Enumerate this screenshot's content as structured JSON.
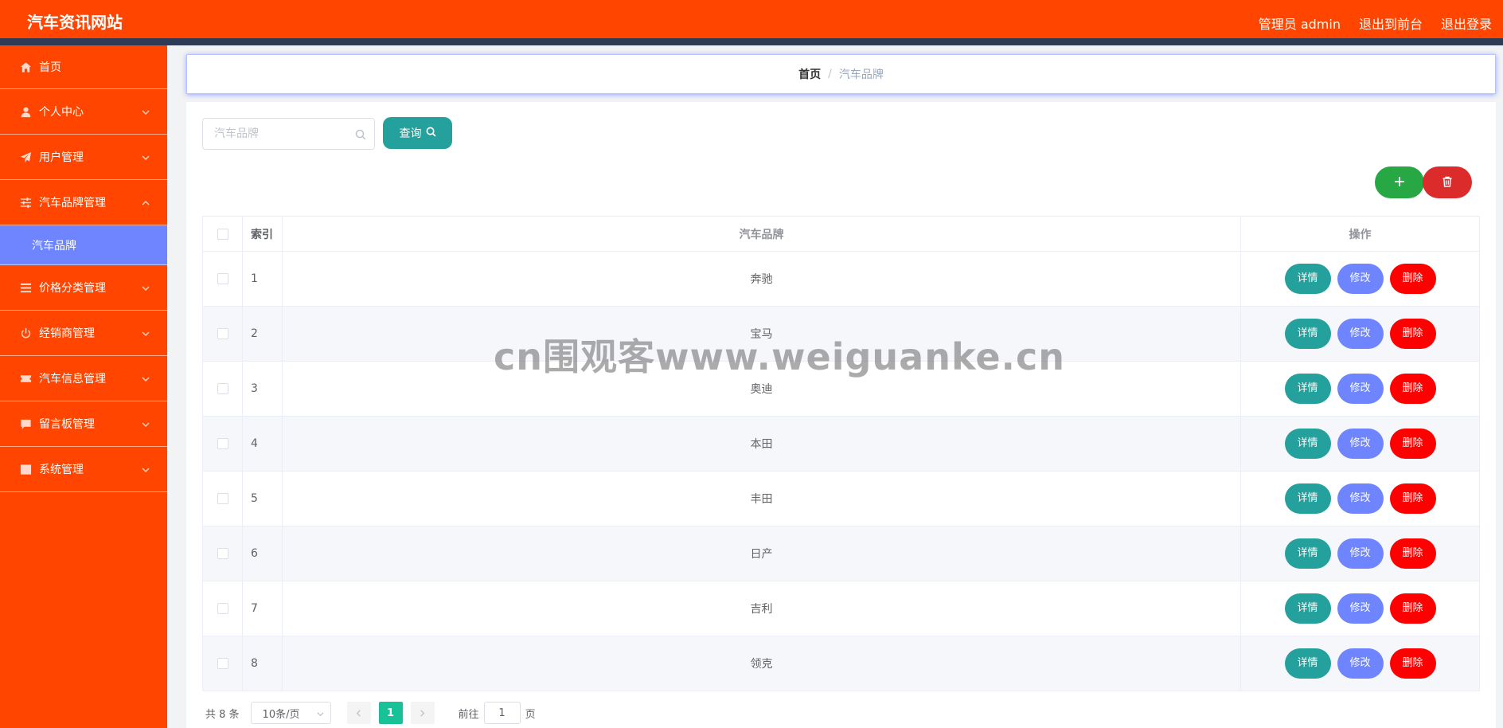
{
  "header": {
    "title": "汽车资讯网站",
    "user": "管理员 admin",
    "to_front": "退出到前台",
    "logout": "退出登录"
  },
  "sidebar": {
    "items": [
      {
        "label": "首页",
        "icon": "home-icon"
      },
      {
        "label": "个人中心",
        "icon": "user-icon"
      },
      {
        "label": "用户管理",
        "icon": "send-icon"
      },
      {
        "label": "汽车品牌管理",
        "icon": "sliders-icon",
        "expanded": true
      },
      {
        "label": "价格分类管理",
        "icon": "list-icon"
      },
      {
        "label": "经销商管理",
        "icon": "power-icon"
      },
      {
        "label": "汽车信息管理",
        "icon": "ticket-icon"
      },
      {
        "label": "留言板管理",
        "icon": "message-icon"
      },
      {
        "label": "系统管理",
        "icon": "chart-icon"
      }
    ],
    "submenu": {
      "label": "汽车品牌"
    }
  },
  "breadcrumb": {
    "home": "首页",
    "separator": "/",
    "current": "汽车品牌"
  },
  "search": {
    "placeholder": "汽车品牌",
    "query_label": "查询"
  },
  "table": {
    "headers": {
      "index": "索引",
      "name": "汽车品牌",
      "ops": "操作"
    },
    "ops": {
      "detail": "详情",
      "edit": "修改",
      "remove": "删除"
    },
    "rows": [
      {
        "index": "1",
        "name": "奔驰"
      },
      {
        "index": "2",
        "name": "宝马"
      },
      {
        "index": "3",
        "name": "奥迪"
      },
      {
        "index": "4",
        "name": "本田"
      },
      {
        "index": "5",
        "name": "丰田"
      },
      {
        "index": "6",
        "name": "日产"
      },
      {
        "index": "7",
        "name": "吉利"
      },
      {
        "index": "8",
        "name": "领克"
      }
    ]
  },
  "pagination": {
    "total": "共 8 条",
    "page_size": "10条/页",
    "current_page": "1",
    "goto_prefix": "前往",
    "goto_value": "1",
    "goto_suffix": "页"
  },
  "watermark": "cn围观客www.weiguanke.cn",
  "colors": {
    "header": "#ff4500",
    "sidebar": "#ff4500",
    "submenu_active": "#6e85ff",
    "query_button": "#24a19c",
    "add_button": "#28a745",
    "batch_delete_button": "#dc2b2b",
    "detail_button": "#24a19c",
    "edit_button": "#6e85ff",
    "remove_button": "#ff0000",
    "active_page": "#19c199"
  }
}
